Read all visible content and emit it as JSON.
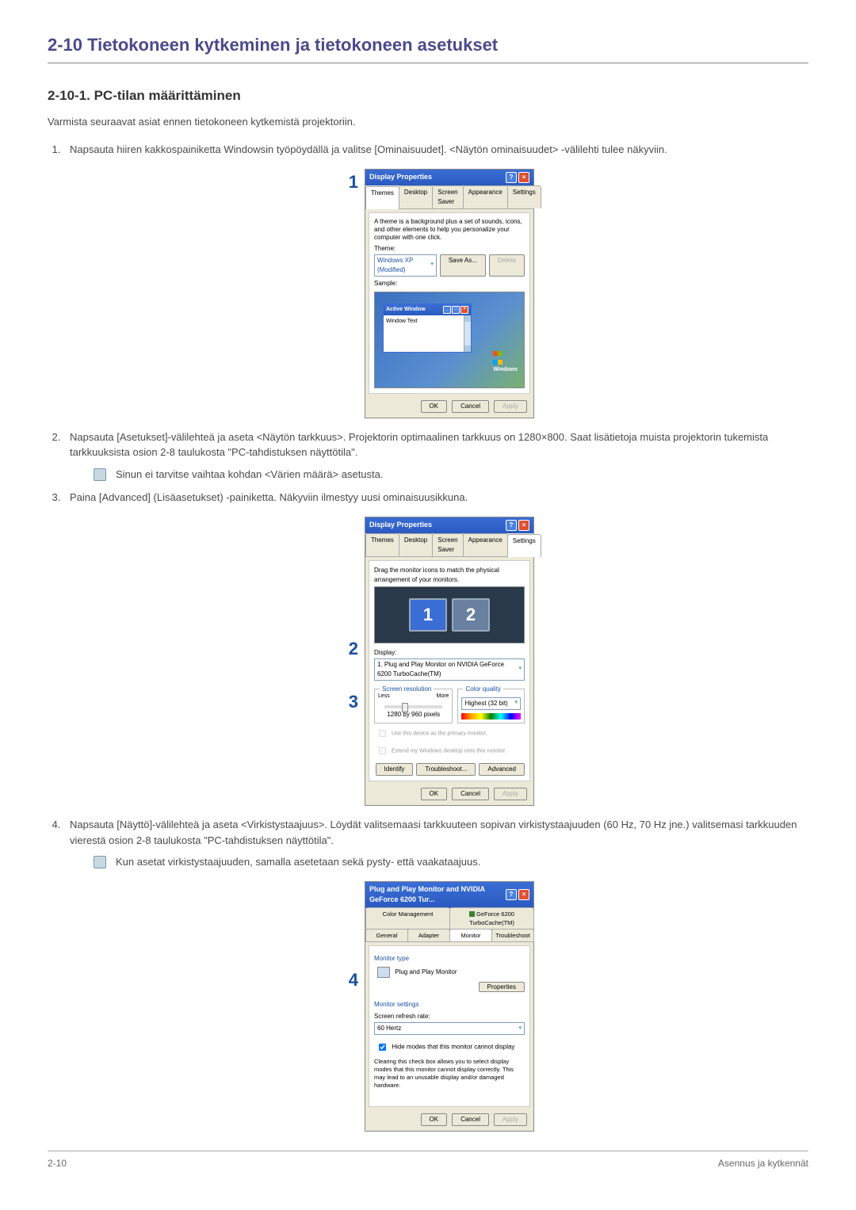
{
  "page": {
    "title": "2-10  Tietokoneen kytkeminen ja tietokoneen asetukset",
    "subtitle": "2-10-1. PC-tilan määrittäminen",
    "intro": "Varmista seuraavat asiat ennen tietokoneen kytkemistä projektoriin.",
    "footer_left": "2-10",
    "footer_right": "Asennus ja kytkennät"
  },
  "steps": {
    "s1": "Napsauta hiiren kakkospainiketta Windowsin työpöydällä ja valitse [Ominaisuudet]. <Näytön ominaisuudet> -välilehti tulee näkyviin.",
    "s2": "Napsauta [Asetukset]-välilehteä ja aseta <Näytön tarkkuus>. Projektorin optimaalinen tarkkuus on 1280×800. Saat lisätietoja muista projektorin tukemista tarkkuuksista osion 2-8 taulukosta \"PC-tahdistuksen näyttötila\".",
    "s2_note": "Sinun ei tarvitse vaihtaa kohdan <Värien määrä> asetusta.",
    "s3": "Paina [Advanced] (Lisäasetukset) -painiketta. Näkyviin ilmestyy uusi ominaisuusikkuna.",
    "s4": "Napsauta [Näyttö]-välilehteä ja aseta <Virkistystaajuus>. Löydät valitsemaasi tarkkuuteen sopivan virkistystaajuuden (60 Hz, 70 Hz jne.) valitsemasi tarkkuuden vierestä osion 2-8 taulukosta \"PC-tahdistuksen näyttötila\".",
    "s4_note": "Kun asetat virkistystaajuuden, samalla asetetaan sekä pysty- että vaakataajuus."
  },
  "callouts": {
    "c1": "1",
    "c2": "2",
    "c3": "3",
    "c4": "4"
  },
  "dlg1": {
    "title": "Display Properties",
    "tabs": {
      "t1": "Themes",
      "t2": "Desktop",
      "t3": "Screen Saver",
      "t4": "Appearance",
      "t5": "Settings"
    },
    "desc": "A theme is a background plus a set of sounds, icons, and other elements to help you personalize your computer with one click.",
    "theme_label": "Theme:",
    "theme_value": "Windows XP (Modified)",
    "save_as": "Save As...",
    "delete": "Delete",
    "sample_label": "Sample:",
    "active_window": "Active Window",
    "window_text": "Window Text",
    "winlogo": "Windows",
    "ok": "OK",
    "cancel": "Cancel",
    "apply": "Apply"
  },
  "dlg2": {
    "title": "Display Properties",
    "tabs": {
      "t1": "Themes",
      "t2": "Desktop",
      "t3": "Screen Saver",
      "t4": "Appearance",
      "t5": "Settings"
    },
    "desc": "Drag the monitor icons to match the physical arrangement of your monitors.",
    "mon1": "1",
    "mon2": "2",
    "display_label": "Display:",
    "display_value": "1. Plug and Play Monitor on NVIDIA GeForce 6200 TurboCache(TM)",
    "res_title": "Screen resolution",
    "less": "Less",
    "more": "More",
    "res_value": "1280 by 960   pixels",
    "cq_title": "Color quality",
    "cq_value": "Highest (32 bit)",
    "chk1": "Use this device as the primary monitor.",
    "chk2": "Extend my Windows desktop onto this monitor.",
    "identify": "Identify",
    "troubleshoot": "Troubleshoot...",
    "advanced": "Advanced",
    "ok": "OK",
    "cancel": "Cancel",
    "apply": "Apply"
  },
  "dlg3": {
    "title": "Plug and Play Monitor and NVIDIA GeForce 6200 Tur...",
    "tabs": {
      "r1c1": "Color Management",
      "r1c2": "GeForce 6200 TurboCache(TM)",
      "r2c1": "General",
      "r2c2": "Adapter",
      "r2c3": "Monitor",
      "r2c4": "Troubleshoot"
    },
    "montype_title": "Monitor type",
    "montype_value": "Plug and Play Monitor",
    "properties": "Properties",
    "monset_title": "Monitor settings",
    "refresh_label": "Screen refresh rate:",
    "refresh_value": "60 Hertz",
    "hide_chk": "Hide modes that this monitor cannot display",
    "hide_desc": "Clearing this check box allows you to select display modes that this monitor cannot display correctly. This may lead to an unusable display and/or damaged hardware.",
    "ok": "OK",
    "cancel": "Cancel",
    "apply": "Apply"
  }
}
